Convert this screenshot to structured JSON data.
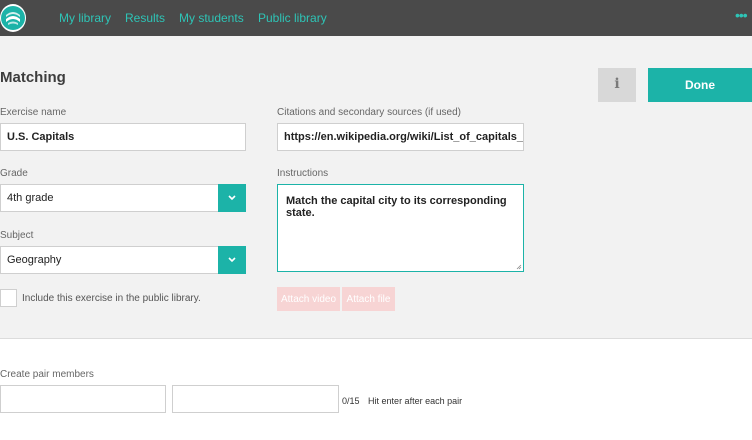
{
  "nav": {
    "links": [
      "My library",
      "Results",
      "My students",
      "Public library"
    ],
    "menu_icon": "ellipsis-icon"
  },
  "page": {
    "title": "Matching",
    "info_label": "i",
    "done_label": "Done"
  },
  "form": {
    "exercise_name_label": "Exercise name",
    "exercise_name_value": "U.S. Capitals",
    "grade_label": "Grade",
    "grade_value": "4th grade",
    "subject_label": "Subject",
    "subject_value": "Geography",
    "public_checkbox_label": "Include this exercise in the public library.",
    "public_checked": false,
    "citations_label": "Citations and secondary sources (if used)",
    "citations_value": "https://en.wikipedia.org/wiki/List_of_capitals_in_t",
    "instructions_label": "Instructions",
    "instructions_value": "Match the capital city to its corresponding state.",
    "attach_video_label": "Attach video",
    "attach_file_label": "Attach file"
  },
  "pairs": {
    "label": "Create pair members",
    "counter": "0/15",
    "hint": "Hit enter after each pair",
    "left_value": "",
    "right_value": ""
  },
  "colors": {
    "accent": "#1cb3a8",
    "nav_link": "#2ec4b6",
    "topbar": "#4a4a4a",
    "attach_disabled": "#f7d4d4"
  }
}
